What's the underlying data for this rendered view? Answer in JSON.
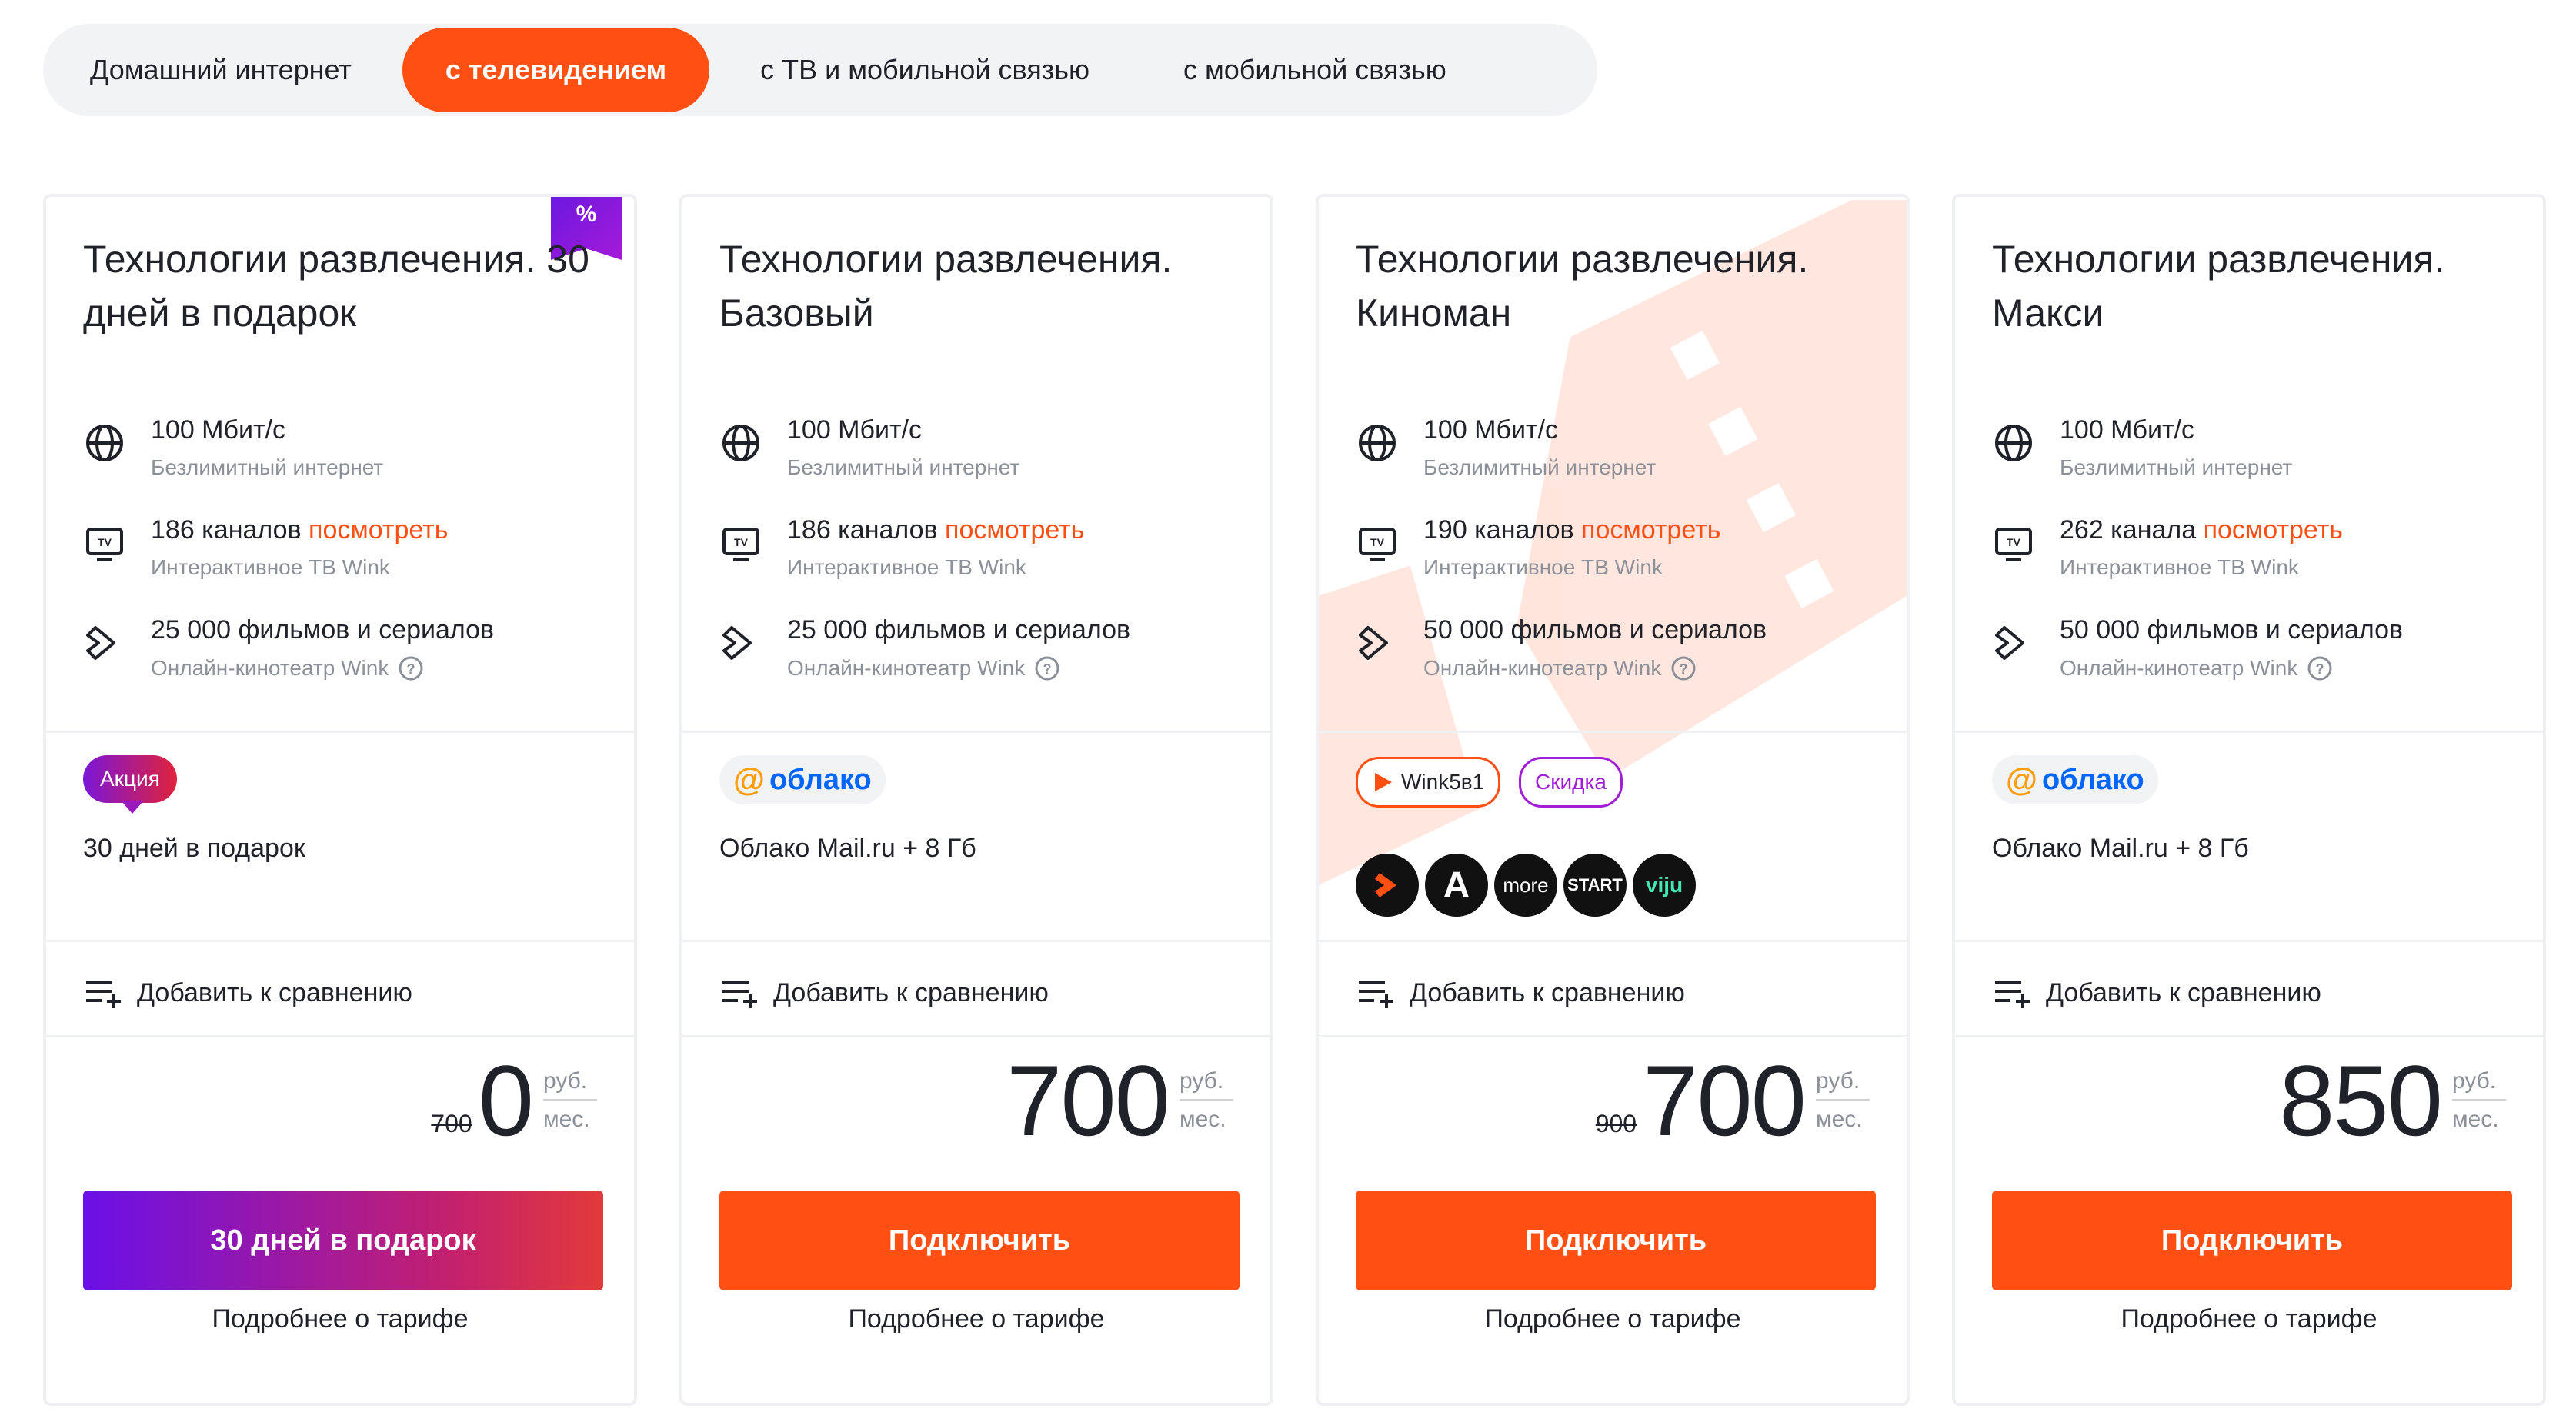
{
  "tabs": [
    {
      "label": "Домашний интернет",
      "active": false
    },
    {
      "label": "с телевидением",
      "active": true
    },
    {
      "label": "с ТВ и мобильной связью",
      "active": false
    },
    {
      "label": "с мобильной связью",
      "active": false
    }
  ],
  "colors": {
    "accent": "#ff4f12",
    "promo_gradient_start": "#6a10e8",
    "promo_gradient_end": "#e33a3a",
    "link": "#ff4f12",
    "cloud_blue": "#0066ff"
  },
  "cards": [
    {
      "title": "Технологии развлечения. 30 дней в подарок",
      "promo_corner": "%",
      "features": {
        "internet": {
          "main": "100 Мбит/с",
          "sub": "Безлимитный интернет"
        },
        "tv": {
          "main": "186 каналов",
          "link": "посмотреть",
          "sub": "Интерактивное ТВ Wink"
        },
        "cinema": {
          "main": "25 000 фильмов и сериалов",
          "sub": "Онлайн-кинотеатр Wink"
        }
      },
      "badge": "Акция",
      "extra": "30 дней в подарок",
      "compare": "Добавить к сравнению",
      "old_price": "700",
      "price": "0",
      "currency": "руб.",
      "period": "мес.",
      "cta": "30 дней в подарок",
      "more": "Подробнее о тарифе"
    },
    {
      "title": "Технологии развлечения. Базовый",
      "features": {
        "internet": {
          "main": "100 Мбит/с",
          "sub": "Безлимитный интернет"
        },
        "tv": {
          "main": "186 каналов",
          "link": "посмотреть",
          "sub": "Интерактивное ТВ Wink"
        },
        "cinema": {
          "main": "25 000 фильмов и сериалов",
          "sub": "Онлайн-кинотеатр Wink"
        }
      },
      "badge_brand": {
        "at": "@",
        "name": "облако"
      },
      "extra": "Облако Mail.ru + 8 Гб",
      "compare": "Добавить к сравнению",
      "price": "700",
      "currency": "руб.",
      "period": "мес.",
      "cta": "Подключить",
      "more": "Подробнее о тарифе"
    },
    {
      "title": "Технологии развлечения. Киноман",
      "features": {
        "internet": {
          "main": "100 Мбит/с",
          "sub": "Безлимитный интернет"
        },
        "tv": {
          "main": "190 каналов",
          "link": "посмотреть",
          "sub": "Интерактивное ТВ Wink"
        },
        "cinema": {
          "main": "50 000 фильмов и сериалов",
          "sub": "Онлайн-кинотеатр Wink"
        }
      },
      "pills": {
        "wink": "Wink5в1",
        "discount": "Скидка"
      },
      "service_logos": [
        {
          "name": "wink-logo",
          "text": ""
        },
        {
          "name": "amediateka-logo",
          "text": "A"
        },
        {
          "name": "more-tv-logo",
          "text": "more"
        },
        {
          "name": "start-logo",
          "text": "START"
        },
        {
          "name": "viju-logo",
          "text": "viju"
        }
      ],
      "compare": "Добавить к сравнению",
      "old_price": "900",
      "price": "700",
      "currency": "руб.",
      "period": "мес.",
      "cta": "Подключить",
      "more": "Подробнее о тарифе"
    },
    {
      "title": "Технологии развлечения. Макси",
      "features": {
        "internet": {
          "main": "100 Мбит/с",
          "sub": "Безлимитный интернет"
        },
        "tv": {
          "main": "262 канала",
          "link": "посмотреть",
          "sub": "Интерактивное ТВ Wink"
        },
        "cinema": {
          "main": "50 000 фильмов и сериалов",
          "sub": "Онлайн-кинотеатр Wink"
        }
      },
      "badge_brand": {
        "at": "@",
        "name": "облако"
      },
      "extra": "Облако Mail.ru + 8 Гб",
      "compare": "Добавить к сравнению",
      "price": "850",
      "currency": "руб.",
      "period": "мес.",
      "cta": "Подключить",
      "more": "Подробнее о тарифе"
    }
  ]
}
